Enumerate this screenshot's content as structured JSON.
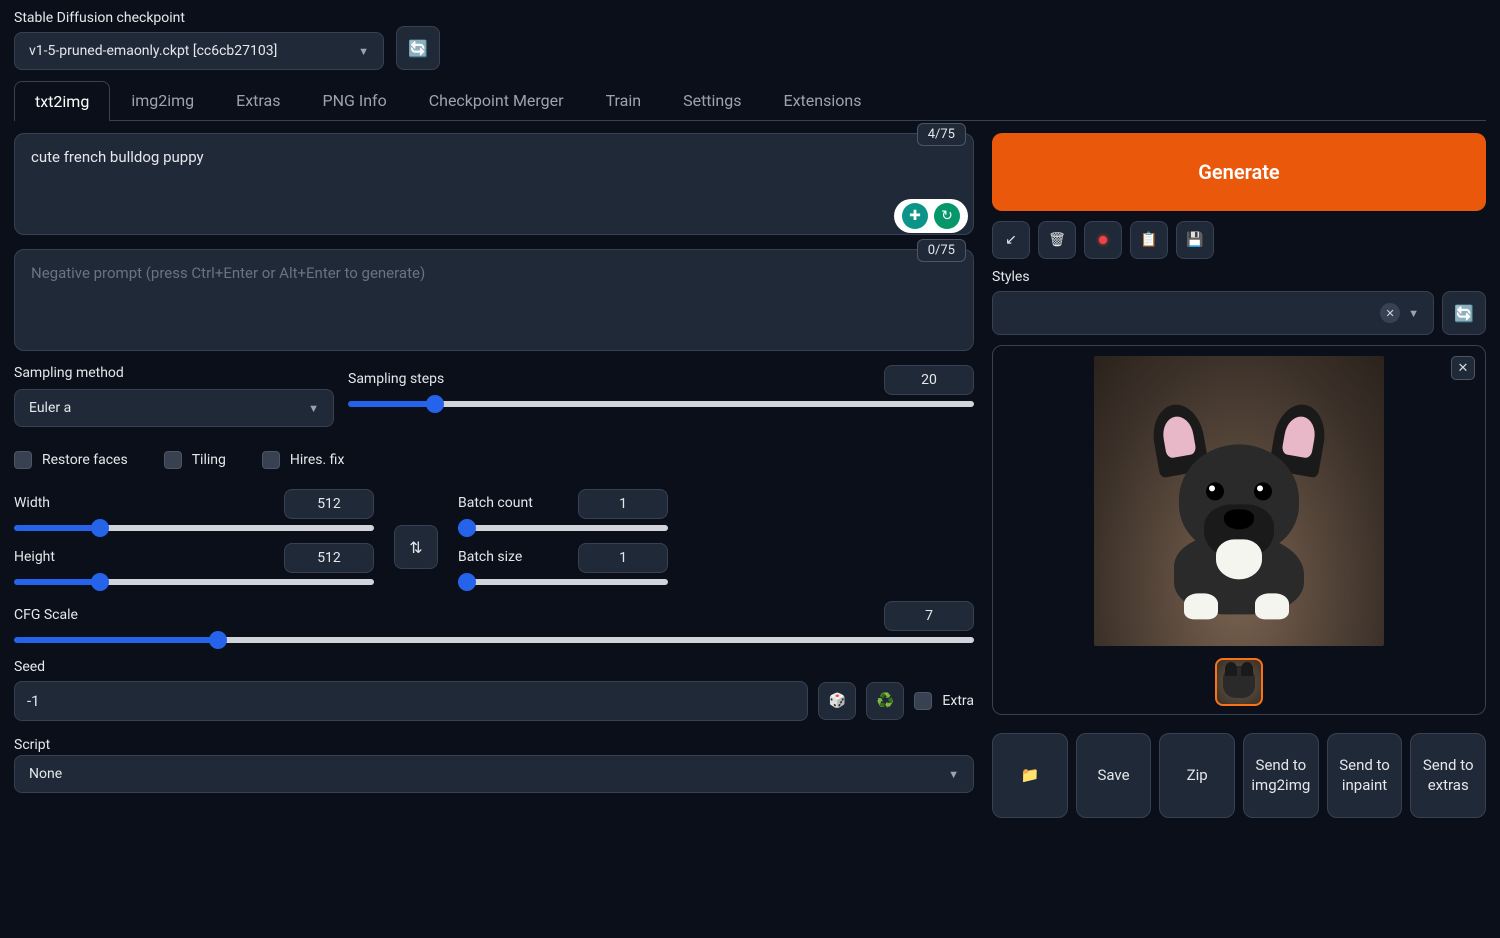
{
  "checkpoint": {
    "label": "Stable Diffusion checkpoint",
    "value": "v1-5-pruned-emaonly.ckpt [cc6cb27103]"
  },
  "tabs": [
    "txt2img",
    "img2img",
    "Extras",
    "PNG Info",
    "Checkpoint Merger",
    "Train",
    "Settings",
    "Extensions"
  ],
  "prompt": {
    "value": "cute french bulldog puppy",
    "count": "4/75"
  },
  "neg_prompt": {
    "placeholder": "Negative prompt (press Ctrl+Enter or Alt+Enter to generate)",
    "count": "0/75"
  },
  "sampling_method": {
    "label": "Sampling method",
    "value": "Euler a"
  },
  "sampling_steps": {
    "label": "Sampling steps",
    "value": "20"
  },
  "checks": {
    "restore": "Restore faces",
    "tiling": "Tiling",
    "hires": "Hires. fix"
  },
  "width": {
    "label": "Width",
    "value": "512"
  },
  "height": {
    "label": "Height",
    "value": "512"
  },
  "batch_count": {
    "label": "Batch count",
    "value": "1"
  },
  "batch_size": {
    "label": "Batch size",
    "value": "1"
  },
  "cfg": {
    "label": "CFG Scale",
    "value": "7"
  },
  "seed": {
    "label": "Seed",
    "value": "-1",
    "extra": "Extra"
  },
  "script": {
    "label": "Script",
    "value": "None"
  },
  "generate": "Generate",
  "styles": {
    "label": "Styles"
  },
  "bottom": {
    "folder": "📁",
    "save": "Save",
    "zip": "Zip",
    "img2img": "Send to img2img",
    "inpaint": "Send to inpaint",
    "extras": "Send to extras"
  },
  "icons": {
    "dice": "🎲",
    "recycle": "♻️",
    "swap": "⇅",
    "refresh": "🔄",
    "arrow_in": "↙",
    "trash": "🗑",
    "clipboard": "📋",
    "floppy": "💾"
  }
}
